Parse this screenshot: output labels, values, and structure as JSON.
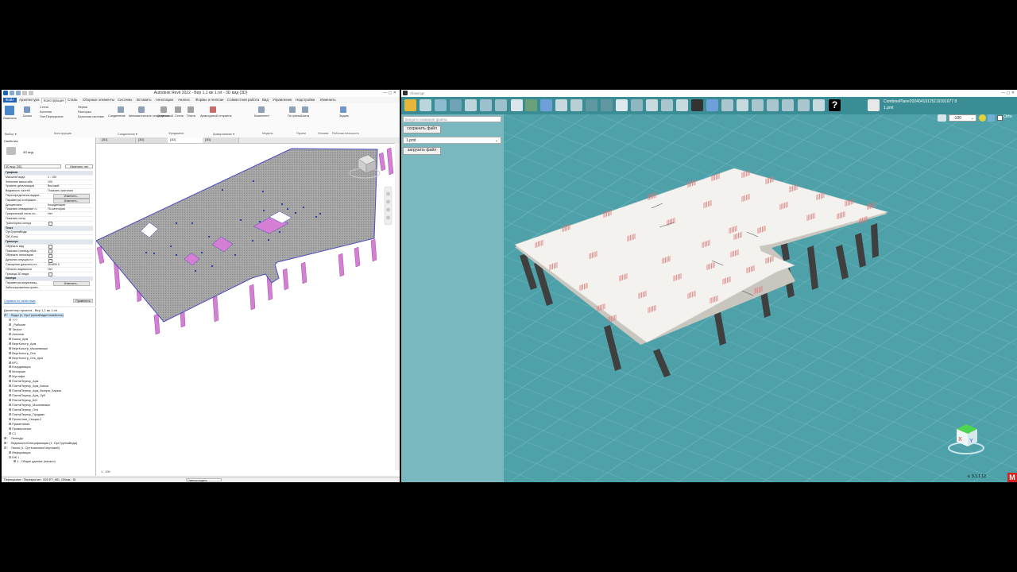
{
  "revit": {
    "title": "Autodesk Revit 2022 - Вер 1,1 кж 1.rvt - 3D вид {3D}",
    "tabs": [
      "Файл",
      "Архитектура",
      "Конструкция",
      "Сталь",
      "Сборные элементы",
      "Системы",
      "Вставить",
      "Аннотации",
      "Анализ",
      "Формы и генплан",
      "Совместная работа",
      "Вид",
      "Управление",
      "Надстройки",
      "Изменить"
    ],
    "active_tab": "Конструкция",
    "ribbon": {
      "modify": "Изменить",
      "beam": "Балка",
      "wall": "Стена",
      "column": "Колонна",
      "floor": "Пол:Перекрытие",
      "truss": "Ферма",
      "brace": "Распорка",
      "beam_system": "Балочная система",
      "connection": "Соединение",
      "connection_auto": "Автоматическое соединение",
      "isolated": "Отдельный",
      "wall_f": "Стена",
      "slab": "Плита",
      "rebar": "Арматурный стержень",
      "model": "Компонент",
      "opening": "По грани",
      "shaft": "Шахта",
      "set": "Задать",
      "panels": [
        "Выбор ▾",
        "Конструкция",
        "Соединение ▾",
        "Фундамент",
        "Армирование ▾",
        "Модель",
        "Проем",
        "Основа",
        "Рабочая плоскость"
      ]
    },
    "props": {
      "header": "Свойства",
      "type": "3D вид",
      "view_select": "3D вид: {3D}",
      "edit_type": "Изменить тип",
      "rows": [
        {
          "k": "Графика",
          "head": true
        },
        {
          "k": "Масштаб вида",
          "v": "1 : 100"
        },
        {
          "k": "Значение масштаба",
          "v": "100"
        },
        {
          "k": "Уровень детализации",
          "v": "Высокий"
        },
        {
          "k": "Видимость частей",
          "v": "Показать оригинал"
        },
        {
          "k": "Переопределения видим...",
          "v": "Изменить...",
          "btn": true
        },
        {
          "k": "Параметры отображен...",
          "v": "Изменить...",
          "btn": true
        },
        {
          "k": "Дисциплина",
          "v": "Координация"
        },
        {
          "k": "Показать невидимые л...",
          "v": "По категории"
        },
        {
          "k": "Графический стиль по...",
          "v": "Нет"
        },
        {
          "k": "Показать сетку",
          "v": ""
        },
        {
          "k": "Траектория солнца",
          "chk": true
        },
        {
          "k": "Текст",
          "head": true
        },
        {
          "k": "Орг.ГруппаВида",
          "v": ""
        },
        {
          "k": "ОИ_Блок",
          "v": ""
        },
        {
          "k": "Границы",
          "head": true
        },
        {
          "k": "Обрезать вид",
          "chk": true
        },
        {
          "k": "Показать границу обре...",
          "chk": true
        },
        {
          "k": "Обрезать аннотацию",
          "chk": true
        },
        {
          "k": "Дальняя секущая пл.",
          "chk": true
        },
        {
          "k": "Смещение дальнего пл...",
          "v": "304800.0"
        },
        {
          "k": "Область видимости",
          "v": "Нет"
        },
        {
          "k": "Границы 3D вида",
          "chk": true
        },
        {
          "k": "Камера",
          "head": true
        },
        {
          "k": "Параметры визуализац...",
          "v": "Изменить...",
          "btn": true
        },
        {
          "k": "Заблокированная ориен...",
          "v": ""
        }
      ],
      "help": "Справка по свойствам",
      "apply": "Применить"
    },
    "browser": {
      "header": "Диспетчер проекта - Вер 1,1 кж 1.rvt",
      "items": [
        {
          "t": "⊟ 🗀 Виды (1. Орг.ГруппаВида/Семейство)",
          "lvl": 0,
          "sel": true
        },
        {
          "t": "⊟ ???",
          "lvl": 1
        },
        {
          "t": "⊞ _Рабочие",
          "lvl": 1
        },
        {
          "t": "⊞ Tardovi",
          "lvl": 1
        },
        {
          "t": "⊞ Антипов",
          "lvl": 1
        },
        {
          "t": "⊞ Балки_Арм",
          "lvl": 1
        },
        {
          "t": "⊞ ВертКонстр_Арм",
          "lvl": 1
        },
        {
          "t": "⊞ ВертКонстр_Мосинвекшн",
          "lvl": 1
        },
        {
          "t": "⊞ ВертКонстр_Отв",
          "lvl": 1
        },
        {
          "t": "⊞ ВертКонстр_Отв_Арм",
          "lvl": 1
        },
        {
          "t": "⊞ КР1",
          "lvl": 1
        },
        {
          "t": "⊞ Координация",
          "lvl": 1
        },
        {
          "t": "⊞ Моторкин",
          "lvl": 1
        },
        {
          "t": "⊞ Мустафа",
          "lvl": 1
        },
        {
          "t": "⊞ ПлитаПерекр_Арм",
          "lvl": 1
        },
        {
          "t": "⊞ ПлитаПерекр_Арм_Балки",
          "lvl": 1
        },
        {
          "t": "⊞ ПлитаПерекр_Арм_Выпуск_Каркас",
          "lvl": 1
        },
        {
          "t": "⊞ ПлитаПерекр_Арм_Зуб",
          "lvl": 1
        },
        {
          "t": "⊞ ПлитаПерекр_Бет",
          "lvl": 1
        },
        {
          "t": "⊞ ПлитаПерекр_Мосинвекшн",
          "lvl": 1
        },
        {
          "t": "⊞ ПлитаПерекр_Отв",
          "lvl": 1
        },
        {
          "t": "⊞ ПлитаПерекр_Продавл",
          "lvl": 1
        },
        {
          "t": "⊞ Проектная_Секция.2",
          "lvl": 1
        },
        {
          "t": "⊞ Примечания",
          "lvl": 1
        },
        {
          "t": "⊞ Проверочные",
          "lvl": 1
        },
        {
          "t": "⊞ С1",
          "lvl": 1
        },
        {
          "t": "⊞ 🗀 Легенды",
          "lvl": 0
        },
        {
          "t": "⊞ 🗀 Ведомости/Спецификации (1. Орг.ГруппаВида)",
          "lvl": 0
        },
        {
          "t": "⊟ 🗀 Листы (1. Орг.Комплект/Чертежей)",
          "lvl": 0
        },
        {
          "t": "⊞ Информация",
          "lvl": 1
        },
        {
          "t": "⊟ КЖ 1",
          "lvl": 1
        },
        {
          "t": "⊞ 1 - Общие данные (начало)",
          "lvl": 2
        }
      ]
    },
    "view_tabs": [
      "{3D}",
      "{3D}",
      "{3D}",
      "{3D}"
    ],
    "scale_label": "1 : 100",
    "status_text": "Перекрытие : Перекрытие : 825 ЕТ_ЖБ_150мм : ID",
    "status_field": "Главная модель"
  },
  "app": {
    "title": "Shavings",
    "file_input_placeholder": "введите название файла",
    "save_button": "сохранить файл",
    "file_select": "1.pmt",
    "load_button": "загрузить файл",
    "file_name": "CombinePlane20240419125119181677 8",
    "file_sub": "1.pmt",
    "zoom_value": "-100",
    "ortho_label": "Orto",
    "version": "v. 3.1.1.12"
  },
  "colors": {
    "revit_accent": "#1f63b4",
    "column_magenta": "#d47fd3",
    "slab_gray": "#9c9c9c",
    "app_bg": "#4ea1a9",
    "app_panel": "#7ab8bf",
    "slab_white": "#f4f2ee",
    "column_dark": "#3f3f3f",
    "rebar_pink": "#e07878"
  }
}
